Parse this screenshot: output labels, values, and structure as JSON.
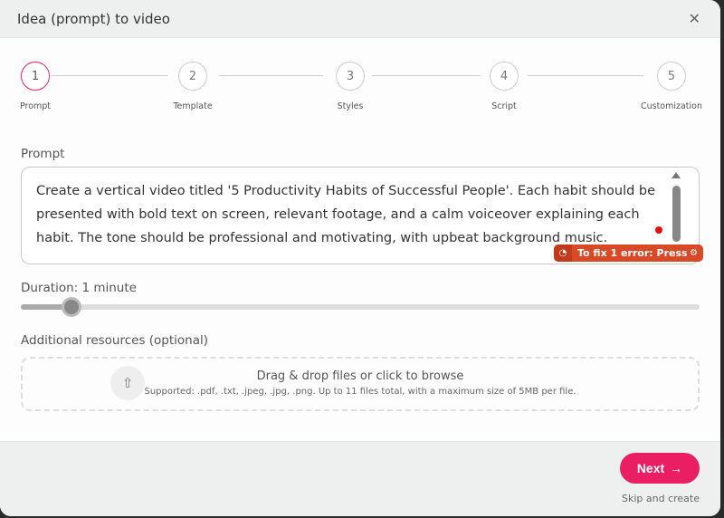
{
  "dialog": {
    "title": "Idea (prompt) to video",
    "close_icon": "close-icon"
  },
  "steps": [
    {
      "num": "1",
      "label": "Prompt",
      "active": true
    },
    {
      "num": "2",
      "label": "Template"
    },
    {
      "num": "3",
      "label": "Styles"
    },
    {
      "num": "4",
      "label": "Script"
    },
    {
      "num": "5",
      "label": "Customization"
    }
  ],
  "prompt": {
    "label": "Prompt",
    "value": "Create a vertical video titled '5 Productivity Habits of Successful People'. Each habit should be presented with bold text on screen, relevant footage, and a calm voiceover explaining each habit. The tone should be professional and motivating, with upbeat background music."
  },
  "grammar": {
    "error_text": "To fix 1 error: Press"
  },
  "duration": {
    "label": "Duration: 1 minute",
    "level_percent": 7.5
  },
  "resources": {
    "label": "Additional resources (optional)",
    "drop_title": "Drag & drop files or click to browse",
    "drop_subtitle": "Supported: .pdf, .txt, .jpeg, .jpg, .png. Up to 11 files total, with a maximum size of 5MB per file."
  },
  "footer": {
    "next_label": "Next",
    "next_icon": "→",
    "skip_label": "Skip and create"
  },
  "colors": {
    "accent": "#ea1f63",
    "error": "#d84a27"
  }
}
